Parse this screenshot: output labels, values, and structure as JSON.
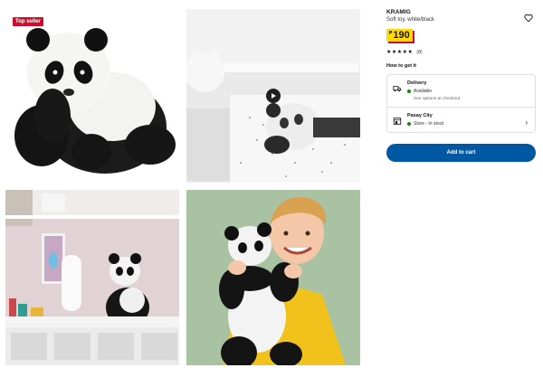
{
  "badge": {
    "label": "Top seller"
  },
  "product": {
    "name": "KRAMIG",
    "description": "Soft toy, white/black",
    "currency": "₱",
    "price": "190",
    "stars": "★★★★★",
    "rating_count": "(8)"
  },
  "availability": {
    "heading": "How to get it",
    "delivery": {
      "title": "Delivery",
      "status": "Available",
      "note": "See options at checkout"
    },
    "store": {
      "title": "Pasay City",
      "status": "Store - In stock"
    }
  },
  "actions": {
    "add_to_cart": "Add to cart"
  },
  "gallery": {
    "images": [
      "panda-plush-front",
      "panda-bedroom-video",
      "panda-on-shelf",
      "child-holding-panda"
    ],
    "has_video": true
  },
  "colors": {
    "badge": "#c8102e",
    "price_bg": "#ffdb00",
    "button": "#0058a3",
    "in_stock": "#0a8a00"
  }
}
